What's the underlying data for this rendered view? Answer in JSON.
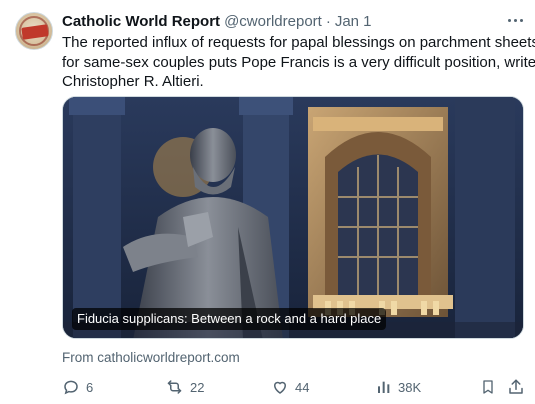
{
  "tweet": {
    "author_name": "Catholic World Report",
    "author_handle": "@cworldreport",
    "separator": "·",
    "date": "Jan 1",
    "text_lines": [
      "The reported influx of requests for papal blessings on parchment sheets",
      "for same-sex couples puts Pope Francis is a very difficult position, writes",
      "Christopher R. Altieri."
    ]
  },
  "card": {
    "title": "Fiducia supplicans: Between a rock and a hard place",
    "source": "From catholicworldreport.com"
  },
  "actions": {
    "replies": "6",
    "reposts": "22",
    "likes": "44",
    "views": "38K"
  },
  "icons": [
    "more-icon",
    "reply-icon",
    "repost-icon",
    "like-icon",
    "views-icon",
    "bookmark-icon",
    "share-icon"
  ],
  "colors": {
    "text": "#0f1419",
    "secondary": "#536471",
    "border": "#cfd9de"
  }
}
